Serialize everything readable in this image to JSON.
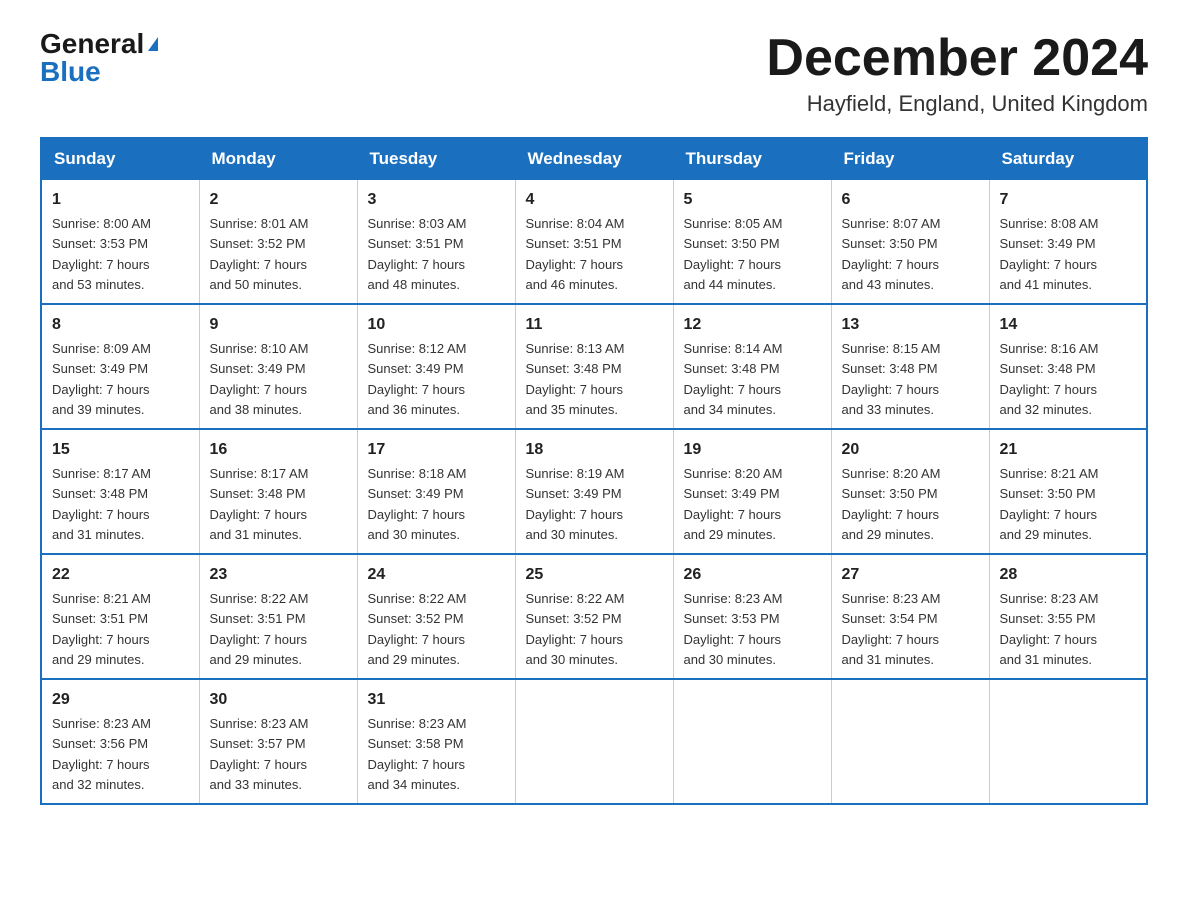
{
  "logo": {
    "general": "General",
    "blue": "Blue"
  },
  "title": "December 2024",
  "location": "Hayfield, England, United Kingdom",
  "days_of_week": [
    "Sunday",
    "Monday",
    "Tuesday",
    "Wednesday",
    "Thursday",
    "Friday",
    "Saturday"
  ],
  "weeks": [
    [
      {
        "day": "1",
        "sunrise": "Sunrise: 8:00 AM",
        "sunset": "Sunset: 3:53 PM",
        "daylight": "Daylight: 7 hours",
        "daylight2": "and 53 minutes."
      },
      {
        "day": "2",
        "sunrise": "Sunrise: 8:01 AM",
        "sunset": "Sunset: 3:52 PM",
        "daylight": "Daylight: 7 hours",
        "daylight2": "and 50 minutes."
      },
      {
        "day": "3",
        "sunrise": "Sunrise: 8:03 AM",
        "sunset": "Sunset: 3:51 PM",
        "daylight": "Daylight: 7 hours",
        "daylight2": "and 48 minutes."
      },
      {
        "day": "4",
        "sunrise": "Sunrise: 8:04 AM",
        "sunset": "Sunset: 3:51 PM",
        "daylight": "Daylight: 7 hours",
        "daylight2": "and 46 minutes."
      },
      {
        "day": "5",
        "sunrise": "Sunrise: 8:05 AM",
        "sunset": "Sunset: 3:50 PM",
        "daylight": "Daylight: 7 hours",
        "daylight2": "and 44 minutes."
      },
      {
        "day": "6",
        "sunrise": "Sunrise: 8:07 AM",
        "sunset": "Sunset: 3:50 PM",
        "daylight": "Daylight: 7 hours",
        "daylight2": "and 43 minutes."
      },
      {
        "day": "7",
        "sunrise": "Sunrise: 8:08 AM",
        "sunset": "Sunset: 3:49 PM",
        "daylight": "Daylight: 7 hours",
        "daylight2": "and 41 minutes."
      }
    ],
    [
      {
        "day": "8",
        "sunrise": "Sunrise: 8:09 AM",
        "sunset": "Sunset: 3:49 PM",
        "daylight": "Daylight: 7 hours",
        "daylight2": "and 39 minutes."
      },
      {
        "day": "9",
        "sunrise": "Sunrise: 8:10 AM",
        "sunset": "Sunset: 3:49 PM",
        "daylight": "Daylight: 7 hours",
        "daylight2": "and 38 minutes."
      },
      {
        "day": "10",
        "sunrise": "Sunrise: 8:12 AM",
        "sunset": "Sunset: 3:49 PM",
        "daylight": "Daylight: 7 hours",
        "daylight2": "and 36 minutes."
      },
      {
        "day": "11",
        "sunrise": "Sunrise: 8:13 AM",
        "sunset": "Sunset: 3:48 PM",
        "daylight": "Daylight: 7 hours",
        "daylight2": "and 35 minutes."
      },
      {
        "day": "12",
        "sunrise": "Sunrise: 8:14 AM",
        "sunset": "Sunset: 3:48 PM",
        "daylight": "Daylight: 7 hours",
        "daylight2": "and 34 minutes."
      },
      {
        "day": "13",
        "sunrise": "Sunrise: 8:15 AM",
        "sunset": "Sunset: 3:48 PM",
        "daylight": "Daylight: 7 hours",
        "daylight2": "and 33 minutes."
      },
      {
        "day": "14",
        "sunrise": "Sunrise: 8:16 AM",
        "sunset": "Sunset: 3:48 PM",
        "daylight": "Daylight: 7 hours",
        "daylight2": "and 32 minutes."
      }
    ],
    [
      {
        "day": "15",
        "sunrise": "Sunrise: 8:17 AM",
        "sunset": "Sunset: 3:48 PM",
        "daylight": "Daylight: 7 hours",
        "daylight2": "and 31 minutes."
      },
      {
        "day": "16",
        "sunrise": "Sunrise: 8:17 AM",
        "sunset": "Sunset: 3:48 PM",
        "daylight": "Daylight: 7 hours",
        "daylight2": "and 31 minutes."
      },
      {
        "day": "17",
        "sunrise": "Sunrise: 8:18 AM",
        "sunset": "Sunset: 3:49 PM",
        "daylight": "Daylight: 7 hours",
        "daylight2": "and 30 minutes."
      },
      {
        "day": "18",
        "sunrise": "Sunrise: 8:19 AM",
        "sunset": "Sunset: 3:49 PM",
        "daylight": "Daylight: 7 hours",
        "daylight2": "and 30 minutes."
      },
      {
        "day": "19",
        "sunrise": "Sunrise: 8:20 AM",
        "sunset": "Sunset: 3:49 PM",
        "daylight": "Daylight: 7 hours",
        "daylight2": "and 29 minutes."
      },
      {
        "day": "20",
        "sunrise": "Sunrise: 8:20 AM",
        "sunset": "Sunset: 3:50 PM",
        "daylight": "Daylight: 7 hours",
        "daylight2": "and 29 minutes."
      },
      {
        "day": "21",
        "sunrise": "Sunrise: 8:21 AM",
        "sunset": "Sunset: 3:50 PM",
        "daylight": "Daylight: 7 hours",
        "daylight2": "and 29 minutes."
      }
    ],
    [
      {
        "day": "22",
        "sunrise": "Sunrise: 8:21 AM",
        "sunset": "Sunset: 3:51 PM",
        "daylight": "Daylight: 7 hours",
        "daylight2": "and 29 minutes."
      },
      {
        "day": "23",
        "sunrise": "Sunrise: 8:22 AM",
        "sunset": "Sunset: 3:51 PM",
        "daylight": "Daylight: 7 hours",
        "daylight2": "and 29 minutes."
      },
      {
        "day": "24",
        "sunrise": "Sunrise: 8:22 AM",
        "sunset": "Sunset: 3:52 PM",
        "daylight": "Daylight: 7 hours",
        "daylight2": "and 29 minutes."
      },
      {
        "day": "25",
        "sunrise": "Sunrise: 8:22 AM",
        "sunset": "Sunset: 3:52 PM",
        "daylight": "Daylight: 7 hours",
        "daylight2": "and 30 minutes."
      },
      {
        "day": "26",
        "sunrise": "Sunrise: 8:23 AM",
        "sunset": "Sunset: 3:53 PM",
        "daylight": "Daylight: 7 hours",
        "daylight2": "and 30 minutes."
      },
      {
        "day": "27",
        "sunrise": "Sunrise: 8:23 AM",
        "sunset": "Sunset: 3:54 PM",
        "daylight": "Daylight: 7 hours",
        "daylight2": "and 31 minutes."
      },
      {
        "day": "28",
        "sunrise": "Sunrise: 8:23 AM",
        "sunset": "Sunset: 3:55 PM",
        "daylight": "Daylight: 7 hours",
        "daylight2": "and 31 minutes."
      }
    ],
    [
      {
        "day": "29",
        "sunrise": "Sunrise: 8:23 AM",
        "sunset": "Sunset: 3:56 PM",
        "daylight": "Daylight: 7 hours",
        "daylight2": "and 32 minutes."
      },
      {
        "day": "30",
        "sunrise": "Sunrise: 8:23 AM",
        "sunset": "Sunset: 3:57 PM",
        "daylight": "Daylight: 7 hours",
        "daylight2": "and 33 minutes."
      },
      {
        "day": "31",
        "sunrise": "Sunrise: 8:23 AM",
        "sunset": "Sunset: 3:58 PM",
        "daylight": "Daylight: 7 hours",
        "daylight2": "and 34 minutes."
      },
      null,
      null,
      null,
      null
    ]
  ]
}
